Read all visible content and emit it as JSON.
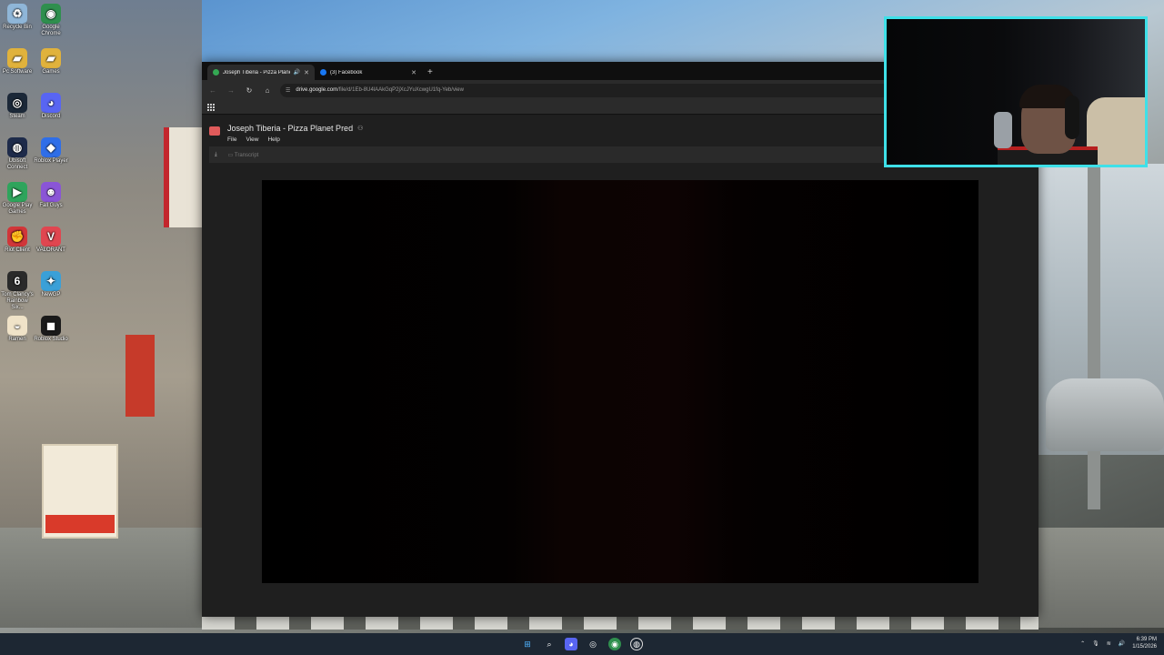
{
  "desktop": {
    "icons": [
      {
        "label": "Recycle Bin",
        "glyph": "♻",
        "color": "#8fb6d8"
      },
      {
        "label": "Google Chrome",
        "glyph": "◉",
        "color": "#2f8f4e"
      },
      {
        "label": "Pc Software",
        "glyph": "▰",
        "color": "#e0b23c"
      },
      {
        "label": "Games",
        "glyph": "▰",
        "color": "#e0b23c"
      },
      {
        "label": "Steam",
        "glyph": "◎",
        "color": "#1b2838"
      },
      {
        "label": "Discord",
        "glyph": "◕",
        "color": "#5865f2"
      },
      {
        "label": "Ubisoft Connect",
        "glyph": "◍",
        "color": "#1e2b4a"
      },
      {
        "label": "Roblox Player",
        "glyph": "◆",
        "color": "#2f6ee8"
      },
      {
        "label": "Google Play Games",
        "glyph": "▶",
        "color": "#2fa45c"
      },
      {
        "label": "Fall Guys",
        "glyph": "☻",
        "color": "#8a55d6"
      },
      {
        "label": "Riot Client",
        "glyph": "✊",
        "color": "#d13639"
      },
      {
        "label": "VALORANT",
        "glyph": "V",
        "color": "#e04650"
      },
      {
        "label": "Tom Clancy's Rainbow Six...",
        "glyph": "6",
        "color": "#2a2a2a"
      },
      {
        "label": "NewGP",
        "glyph": "✦",
        "color": "#3aa0d8"
      },
      {
        "label": "Ramen",
        "glyph": "◒",
        "color": "#f0e3c8"
      },
      {
        "label": "Roblox Studio",
        "glyph": "◼",
        "color": "#1a1a1a"
      }
    ]
  },
  "browser": {
    "tabs": [
      {
        "title": "Joseph Tiberia - Pizza Planet",
        "favicon_color": "#34a853",
        "active": true,
        "audio": true
      },
      {
        "title": "(3) Facebook",
        "favicon_color": "#1877f2",
        "active": false,
        "audio": false
      }
    ],
    "new_tab_glyph": "+",
    "close_glyph": "✕",
    "address": {
      "host": "drive.google.com",
      "path": "/file/d/1Eb-8U4lAAkGqP2jXcJYuXcwgU1fq-Yeb/view"
    }
  },
  "drive": {
    "file_title": "Joseph Tiberia - Pizza Planet Pred",
    "menu": [
      "File",
      "View",
      "Help"
    ],
    "subbar_transcript": "Transcript"
  },
  "taskbar": {
    "time": "6:39 PM",
    "date": "1/15/2026"
  }
}
